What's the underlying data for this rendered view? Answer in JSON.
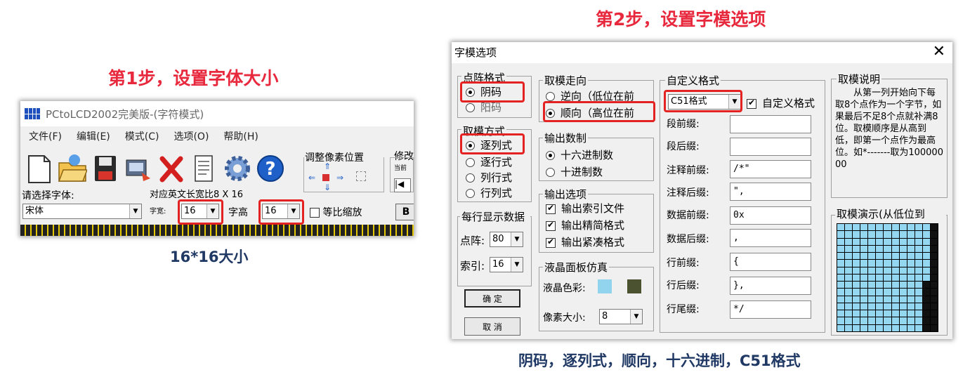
{
  "step1": {
    "title": "第1步，设置字体大小",
    "caption": "16*16大小"
  },
  "step2": {
    "title": "第2步，设置字模选项",
    "caption": "阴码，逐列式，顺向，十六进制，C51格式"
  },
  "app": {
    "title": "PCtoLCD2002完美版-(字符模式)",
    "menu": [
      "文件(F)",
      "编辑(E)",
      "模式(C)",
      "选项(O)",
      "帮助(H)"
    ],
    "toolbar_icons": [
      "new-file-icon",
      "open-folder-icon",
      "save-disk-icon",
      "generate-icon",
      "delete-icon",
      "notepad-icon",
      "settings-gear-icon",
      "help-icon"
    ],
    "adjust_label": "调整像素位置",
    "modify_label": "修改",
    "current_label": "当前",
    "font_label": "请选择字体:",
    "font_value": "宋体",
    "ratio_label": "对应英文长宽比8 X 16",
    "width_label": "字宽:",
    "width_value": "16",
    "height_label": "字高",
    "height_value": "16",
    "scale_label": "等比缩放",
    "bold_label": "B"
  },
  "dialog": {
    "title": "字模选项",
    "dot_format": {
      "title": "点阵格式",
      "options": [
        "阴码",
        "阳码"
      ],
      "selected": "阴码"
    },
    "mode": {
      "title": "取模方式",
      "options": [
        "逐列式",
        "逐行式",
        "列行式",
        "行列式"
      ],
      "selected": "逐列式"
    },
    "per_line": {
      "title": "每行显示数据",
      "dot_label": "点阵:",
      "dot_value": "80",
      "index_label": "索引:",
      "index_value": "16"
    },
    "ok_label": "确  定",
    "cancel_label": "取  消",
    "direction": {
      "title": "取模走向",
      "options": [
        "逆向（低位在前",
        "顺向（高位在前"
      ],
      "selected": "顺向（高位在前"
    },
    "output_base": {
      "title": "输出数制",
      "options": [
        "十六进制数",
        "十进制数"
      ],
      "selected": "十六进制数"
    },
    "output_opts": {
      "title": "输出选项",
      "options": [
        "输出索引文件",
        "输出精简格式",
        "输出紧凑格式"
      ]
    },
    "lcd": {
      "title": "液晶面板仿真",
      "color_label": "液晶色彩:",
      "pixel_label": "像素大小:",
      "pixel_value": "8",
      "colors": [
        "#92d4ee",
        "#4b5230"
      ]
    },
    "custom": {
      "title": "自定义格式",
      "format_value": "C51格式",
      "custom_check_label": "自定义格式",
      "fields": [
        {
          "label": "段前缀:",
          "value": ""
        },
        {
          "label": "段后缀:",
          "value": ""
        },
        {
          "label": "注释前缀:",
          "value": "/*\""
        },
        {
          "label": "注释后缀:",
          "value": "\","
        },
        {
          "label": "数据前缀:",
          "value": "0x"
        },
        {
          "label": "数据后缀:",
          "value": ","
        },
        {
          "label": "行前缀:",
          "value": "{"
        },
        {
          "label": "行后缀:",
          "value": "},"
        },
        {
          "label": "行尾缀:",
          "value": "*/"
        }
      ]
    },
    "explain": {
      "title": "取模说明",
      "text": "从第一列开始向下每取8个点作为一个字节，如果最后不足8个点就补满8位。取模顺序是从高到低，即第一个点作为最高位。如*-------取为10000000"
    },
    "demo": {
      "title": "取模演示(从低位到"
    }
  }
}
